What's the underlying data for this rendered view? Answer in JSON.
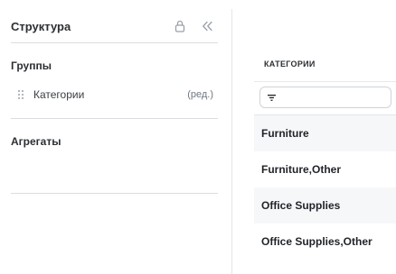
{
  "structure_panel": {
    "title": "Структура",
    "icons": {
      "lock": "lock-icon",
      "collapse": "double-chevron-left-icon"
    },
    "groups_section": {
      "label": "Группы",
      "items": [
        {
          "label": "Категории",
          "action": "(ред.)"
        }
      ]
    },
    "aggregates_section": {
      "label": "Агрегаты"
    }
  },
  "table": {
    "column_header": "КАТЕГОРИИ",
    "filter_icon": "filter-icon",
    "rows": [
      "Furniture",
      "Furniture,Other",
      "Office Supplies",
      "Office Supplies,Other"
    ]
  },
  "colors": {
    "text": "#1f2328",
    "muted": "#6e7781",
    "icon": "#9aa1a9",
    "divider": "#dadde1",
    "row_stripe": "#f6f7f9"
  }
}
